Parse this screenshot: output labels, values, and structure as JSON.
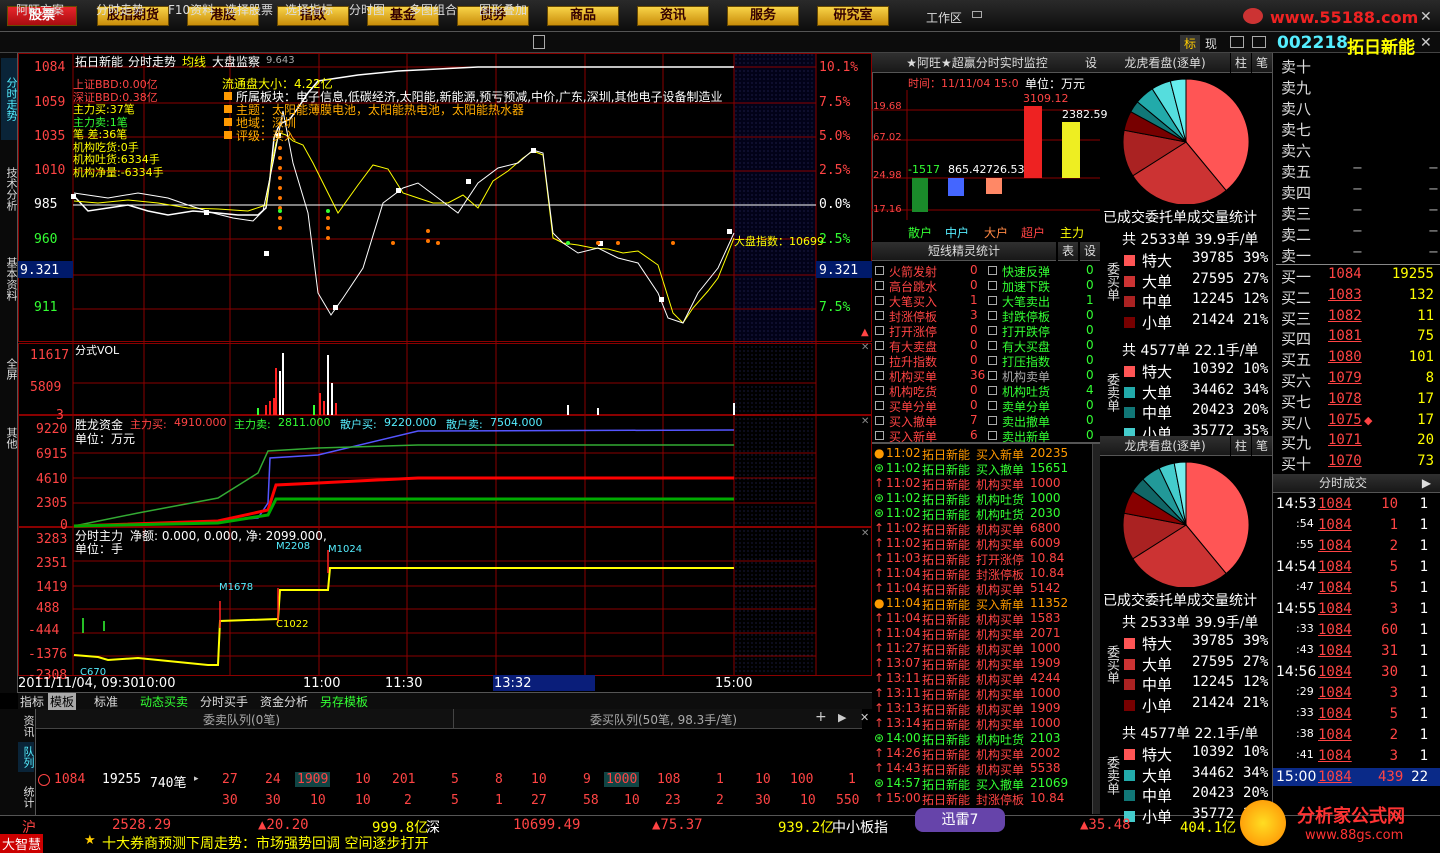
{
  "top_buttons": [
    {
      "label": "股票",
      "active": true
    },
    {
      "label": "股指期货"
    },
    {
      "label": "港股"
    },
    {
      "label": "指数"
    },
    {
      "label": "基金"
    },
    {
      "label": "债券"
    },
    {
      "label": "商品"
    },
    {
      "label": "资讯"
    },
    {
      "label": "服务"
    },
    {
      "label": "研究室"
    }
  ],
  "workspace": "工作区",
  "brand_url": "www.55188.com",
  "toolbar": [
    "阿旺方案",
    "分时走势",
    "F10资料",
    "选择股票",
    "选择指标",
    "分时图",
    "多图组合",
    "图形叠加"
  ],
  "toolbar_right": {
    "biao": "标",
    "xian": "现"
  },
  "stock_title": {
    "code": "002218",
    "name": "拓日新能"
  },
  "vtabs": [
    "分时走势",
    "技术分析",
    "基本资料",
    "全屏",
    "其他"
  ],
  "chart_header": {
    "name": "拓日新能",
    "mode": "分时走势",
    "avg": "均线",
    "monitor": "大盘监察",
    "monitor_val": "9.643"
  },
  "price_axis": {
    "left": [
      "1084",
      "1059",
      "1035",
      "1010",
      "985",
      "960",
      "9.321",
      "911"
    ],
    "right": [
      "10.1%",
      "7.5%",
      "5.0%",
      "2.5%",
      "0.0%",
      "2.5%",
      "9.321",
      "7.5%"
    ]
  },
  "info_overlay": [
    "上证BBD:0.00亿",
    "深证BBD:0.38亿",
    "主力买:37笔",
    "主力卖:1笔",
    "笔  差:36笔",
    "机构吃货:0手",
    "机构吐货:6334手",
    "机构净量:-6334手"
  ],
  "stock_info": [
    "流通盘大小：4.22亿",
    "所属板块：电子信息,低碳经济,太阳能,新能源,预亏预减,中价,广东,深圳,其他电子设备制造业",
    "主题：太阳能薄膜电池，太阳能热电池，太阳能热水器",
    "地域：深圳",
    "评级：买入"
  ],
  "index_label": "大盘指数：10699",
  "vol_panel": {
    "title": "分式VOL",
    "axis": [
      "11617",
      "5809",
      "3"
    ]
  },
  "fund_panel": {
    "title": "胜龙资金",
    "legend": [
      {
        "k": "主力买:",
        "v": "4910.000"
      },
      {
        "k": "主力卖:",
        "v": "2811.000"
      },
      {
        "k": "散户买:",
        "v": "9220.000"
      },
      {
        "k": "散户卖:",
        "v": "7504.000"
      }
    ],
    "unit": "单位：万元",
    "axis": [
      "9220",
      "6915",
      "4610",
      "2305",
      "0"
    ]
  },
  "main_panel": {
    "title": "分时主力",
    "net": "净额: 0.000, 0.000, 净: 2099.000,",
    "unit": "单位：手",
    "axis": [
      "3283",
      "2351",
      "1419",
      "488",
      "-444",
      "-1376",
      "-2308"
    ],
    "marks": [
      "M2208",
      "M1024",
      "M1678",
      "C1022",
      "C670"
    ]
  },
  "time_axis": {
    "date": "2011/11/04, 09:30",
    "ticks": [
      "10:00",
      "11:00",
      "11:30",
      "13:32",
      "15:00"
    ]
  },
  "bottom_tabs": [
    "指标",
    "模板",
    "标准",
    "动态买卖",
    "分时买手",
    "资金分析",
    "另存模板"
  ],
  "side_tabs": [
    "资讯",
    "队列",
    "统计"
  ],
  "queue": {
    "sell_title": "委卖队列(0笔)",
    "buy_title": "委买队列(50笔, 98.3手/笔)",
    "row1": [
      "1084",
      "19255",
      "740笔",
      "27",
      "24",
      "1909",
      "10",
      "201",
      "5",
      "8",
      "10",
      "9",
      "1000",
      "108",
      "1",
      "10",
      "100",
      "1"
    ],
    "row2": [
      "30",
      "30",
      "10",
      "10",
      "2",
      "5",
      "1",
      "27",
      "58",
      "10",
      "23",
      "2",
      "30",
      "10",
      "550"
    ]
  },
  "monitor": {
    "title": "★阿旺★超赢分时实时监控",
    "set": "设",
    "time": "时间：11/11/04 15:0",
    "unit": "单位：万元",
    "bars": [
      {
        "label": "散户",
        "val": "-1517"
      },
      {
        "label": "中户",
        "val": "865.42"
      },
      {
        "label": "大户",
        "val": "726.53"
      },
      {
        "label": "超户",
        "val": "3109.12"
      },
      {
        "label": "主力",
        "val": "2382.59"
      }
    ],
    "axis": [
      "19.68",
      "67.02",
      "24.98",
      "17.16"
    ]
  },
  "shortline": {
    "title": "短线精灵统计",
    "btns": [
      "表",
      "设"
    ],
    "items": [
      [
        "火箭发射",
        "0",
        "快速反弹",
        "0"
      ],
      [
        "高台跳水",
        "0",
        "加速下跌",
        "0"
      ],
      [
        "大笔买入",
        "1",
        "大笔卖出",
        "1"
      ],
      [
        "封涨停板",
        "3",
        "封跌停板",
        "0"
      ],
      [
        "打开涨停",
        "0",
        "打开跌停",
        "0"
      ],
      [
        "有大卖盘",
        "0",
        "有大买盘",
        "0"
      ],
      [
        "拉升指数",
        "0",
        "打压指数",
        "0"
      ],
      [
        "机构买单",
        "36",
        "机构卖单",
        "0"
      ],
      [
        "机构吃货",
        "0",
        "机构吐货",
        "4"
      ],
      [
        "买单分单",
        "0",
        "卖单分单",
        "0"
      ],
      [
        "买入撤单",
        "7",
        "卖出撤单",
        "0"
      ],
      [
        "买入新单",
        "6",
        "卖出新单",
        "0"
      ]
    ]
  },
  "events": [
    [
      "11:02",
      "拓日新能",
      "买入新单",
      "20235",
      "o"
    ],
    [
      "11:02",
      "拓日新能",
      "买入撤单",
      "15651",
      "g"
    ],
    [
      "11:02",
      "拓日新能",
      "机构买单",
      "1000",
      "r"
    ],
    [
      "11:02",
      "拓日新能",
      "机构吐货",
      "1000",
      "g"
    ],
    [
      "11:02",
      "拓日新能",
      "机构吐货",
      "2030",
      "g"
    ],
    [
      "11:02",
      "拓日新能",
      "机构买单",
      "6800",
      "r"
    ],
    [
      "11:02",
      "拓日新能",
      "机构买单",
      "6009",
      "r"
    ],
    [
      "11:03",
      "拓日新能",
      "打开涨停",
      "10.84",
      "r"
    ],
    [
      "11:04",
      "拓日新能",
      "封涨停板",
      "10.84",
      "r"
    ],
    [
      "11:04",
      "拓日新能",
      "机构买单",
      "5142",
      "r"
    ],
    [
      "11:04",
      "拓日新能",
      "买入新单",
      "11352",
      "o"
    ],
    [
      "11:04",
      "拓日新能",
      "机构买单",
      "1583",
      "r"
    ],
    [
      "11:04",
      "拓日新能",
      "机构买单",
      "2071",
      "r"
    ],
    [
      "11:27",
      "拓日新能",
      "机构买单",
      "1000",
      "r"
    ],
    [
      "13:07",
      "拓日新能",
      "机构买单",
      "1909",
      "r"
    ],
    [
      "13:11",
      "拓日新能",
      "机构买单",
      "4244",
      "r"
    ],
    [
      "13:11",
      "拓日新能",
      "机构买单",
      "1000",
      "r"
    ],
    [
      "13:13",
      "拓日新能",
      "机构买单",
      "1909",
      "r"
    ],
    [
      "13:14",
      "拓日新能",
      "机构买单",
      "1000",
      "r"
    ],
    [
      "14:00",
      "拓日新能",
      "机构吐货",
      "2103",
      "g"
    ],
    [
      "14:26",
      "拓日新能",
      "机构买单",
      "2002",
      "r"
    ],
    [
      "14:43",
      "拓日新能",
      "机构买单",
      "5538",
      "r"
    ],
    [
      "14:57",
      "拓日新能",
      "买入撤单",
      "21069",
      "g"
    ],
    [
      "15:00",
      "拓日新能",
      "封涨停板",
      "10.84",
      "r"
    ]
  ],
  "dragon": {
    "title": "龙虎看盘(逐单)",
    "btns": [
      "柱",
      "笔"
    ],
    "subtitle": "已成交委托单成交量统计",
    "buy": {
      "head": "共 2533单 39.9手/单",
      "side": "委买单",
      "rows": [
        [
          "特大",
          "39785",
          "39%"
        ],
        [
          "大单",
          "27595",
          "27%"
        ],
        [
          "中单",
          "12245",
          "12%"
        ],
        [
          "小单",
          "21424",
          "21%"
        ]
      ]
    },
    "sell": {
      "head": "共 4577单 22.1手/单",
      "side": "委卖单",
      "rows": [
        [
          "特大",
          "10392",
          "10%"
        ],
        [
          "大单",
          "34462",
          "34%"
        ],
        [
          "中单",
          "20423",
          "20%"
        ],
        [
          "小单",
          "35772",
          "35%"
        ]
      ]
    }
  },
  "orderbook": {
    "sell": [
      "卖十",
      "卖九",
      "卖八",
      "卖七",
      "卖六",
      "卖五",
      "卖四",
      "卖三",
      "卖二",
      "卖一"
    ],
    "sell_vals": [
      "",
      "",
      "",
      "",
      "",
      "−",
      "−",
      "−",
      "−",
      "−"
    ],
    "buy": [
      [
        "买一",
        "1084",
        "19255"
      ],
      [
        "买二",
        "1083",
        "132"
      ],
      [
        "买三",
        "1082",
        "11"
      ],
      [
        "买四",
        "1081",
        "75"
      ],
      [
        "买五",
        "1080",
        "101"
      ],
      [
        "买六",
        "1079",
        "8"
      ],
      [
        "买七",
        "1078",
        "17"
      ],
      [
        "买八",
        "1075",
        "17"
      ],
      [
        "买九",
        "1071",
        "20"
      ],
      [
        "买十",
        "1070",
        "73"
      ]
    ]
  },
  "ticks": {
    "title": "分时成交",
    "rows": [
      [
        "14:53",
        "1084",
        "10",
        "1"
      ],
      [
        ":54",
        "1084",
        "1",
        "1"
      ],
      [
        ":55",
        "1084",
        "2",
        "1"
      ],
      [
        "14:54",
        "1084",
        "5",
        "1"
      ],
      [
        ":47",
        "1084",
        "5",
        "1"
      ],
      [
        "14:55",
        "1084",
        "3",
        "1"
      ],
      [
        ":33",
        "1084",
        "60",
        "1"
      ],
      [
        ":43",
        "1084",
        "31",
        "1"
      ],
      [
        "14:56",
        "1084",
        "30",
        "1"
      ],
      [
        ":29",
        "1084",
        "3",
        "1"
      ],
      [
        ":33",
        "1084",
        "5",
        "1"
      ],
      [
        ":38",
        "1084",
        "2",
        "1"
      ],
      [
        ":41",
        "1084",
        "3",
        "1"
      ],
      [
        "15:00",
        "1084",
        "439",
        "22"
      ]
    ]
  },
  "status": {
    "hu": "沪",
    "hu_val": "2528.29",
    "hu_chg": "▲20.20",
    "hu_amt": "999.8亿",
    "shen": "深",
    "shen_val": "10699.49",
    "shen_chg": "▲75.37",
    "shen_amt": "939.2亿",
    "zxb": "中小板指",
    "zxb_chg": "▲35.48",
    "zxb_amt": "404.1亿",
    "ticker": "十大券商预测下周走势：市场强势回调 空间逐步打开",
    "logo": "大智慧",
    "xunlei": "迅雷7",
    "ad": "分析家公式网",
    "ad_url": "www.88gs.com"
  }
}
